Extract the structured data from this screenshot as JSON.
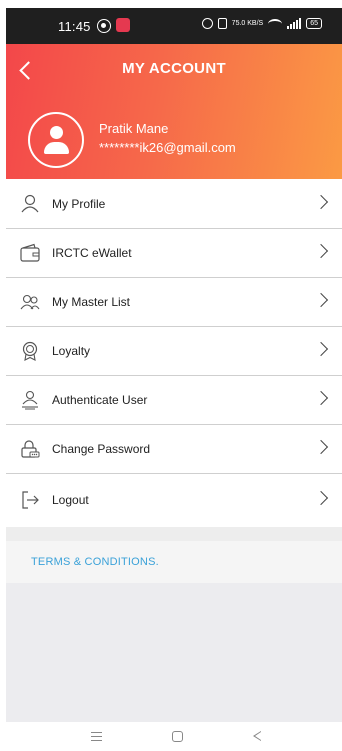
{
  "status_bar": {
    "time": "11:45",
    "speed": "75.0 KB/S",
    "battery": "65"
  },
  "header": {
    "title": "MY ACCOUNT",
    "user_name": "Pratik Mane",
    "user_email": "********ik26@gmail.com",
    "gradient_start": "#f3474a",
    "gradient_end": "#fb9a44"
  },
  "menu": {
    "items": [
      {
        "label": "My Profile",
        "icon": "user-outline-icon"
      },
      {
        "label": "IRCTC eWallet",
        "icon": "wallet-icon"
      },
      {
        "label": "My Master List",
        "icon": "users-icon"
      },
      {
        "label": "Loyalty",
        "icon": "badge-icon"
      },
      {
        "label": "Authenticate User",
        "icon": "authenticate-icon"
      },
      {
        "label": "Change Password",
        "icon": "lock-icon"
      },
      {
        "label": "Logout",
        "icon": "logout-icon"
      }
    ]
  },
  "footer": {
    "terms_label": "TERMS & CONDITIONS.",
    "link_color": "#3aa1d8"
  }
}
